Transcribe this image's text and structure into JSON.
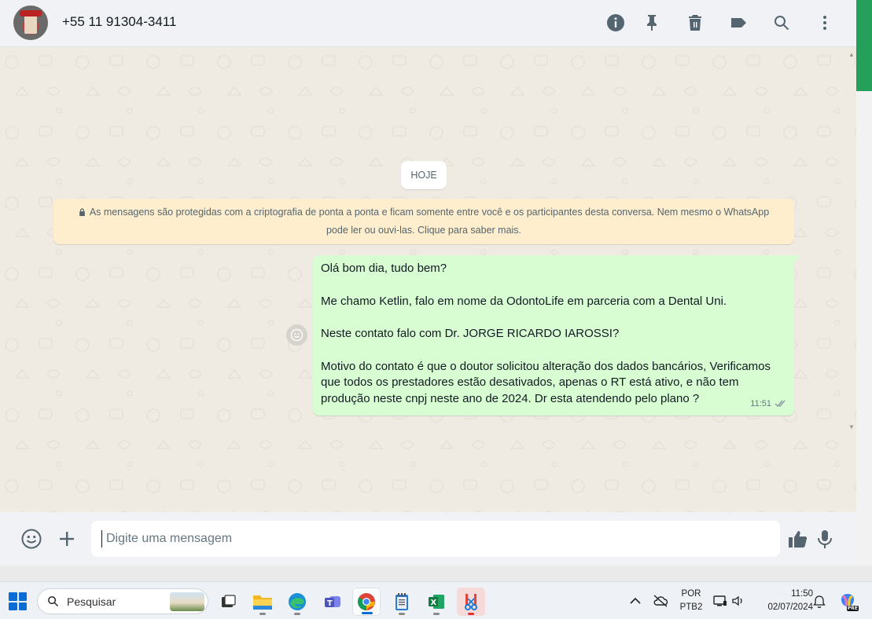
{
  "header": {
    "contact_name": "+55 11 91304-3411",
    "icons": [
      "info-icon",
      "pin-icon",
      "delete-icon",
      "label-icon",
      "search-icon",
      "menu-icon"
    ]
  },
  "chat": {
    "date_label": "HOJE",
    "encryption_notice": "As mensagens são protegidas com a criptografia de ponta a ponta e ficam somente entre você e os participantes desta conversa. Nem mesmo o WhatsApp pode ler ou ouvi-las. Clique para saber mais.",
    "message": {
      "lines": [
        "Olá bom dia, tudo bem?",
        "Me chamo Ketlin, falo em nome da OdontoLife em parceria com a Dental Uni.",
        "Neste contato falo com Dr. JORGE RICARDO IAROSSI?",
        "Motivo do contato é que o doutor solicitou alteração dos dados bancários, Verificamos que todos os prestadores estão desativados, apenas o RT está ativo, e não tem produção neste cnpj neste ano de 2024. Dr esta atendendo pelo plano ?"
      ],
      "time": "11:51",
      "status": "delivered"
    }
  },
  "composer": {
    "placeholder": "Digite uma mensagem"
  },
  "taskbar": {
    "search_placeholder": "Pesquisar",
    "language_top": "POR",
    "language_bottom": "PTB2",
    "clock_time": "11:50",
    "clock_date": "02/07/2024",
    "copilot_badge": "PRE"
  },
  "colors": {
    "chat_bg": "#efeae2",
    "outgoing_bubble": "#d9fdd3",
    "notice_bg": "#ffeecd",
    "accent_green": "#25a05a"
  }
}
